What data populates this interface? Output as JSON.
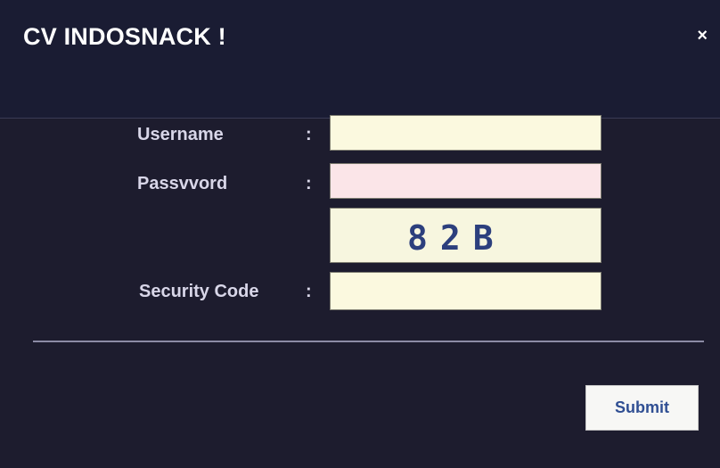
{
  "window": {
    "title": "CV INDOSNACK !",
    "close_label": "×"
  },
  "form": {
    "username": {
      "label": "Username",
      "colon": ":",
      "value": ""
    },
    "password": {
      "label": "Passvvord",
      "colon": ":",
      "value": ""
    },
    "captcha": {
      "code": "82B"
    },
    "security_code": {
      "label": "Security Code",
      "colon": ":",
      "value": ""
    }
  },
  "actions": {
    "submit_label": "Submit"
  },
  "colors": {
    "dialog_bg": "#1d1c2e",
    "field_bg": "#fbf9df",
    "password_bg": "#fbe5e8",
    "captcha_text": "#2c3f7d",
    "submit_text": "#304f93"
  }
}
